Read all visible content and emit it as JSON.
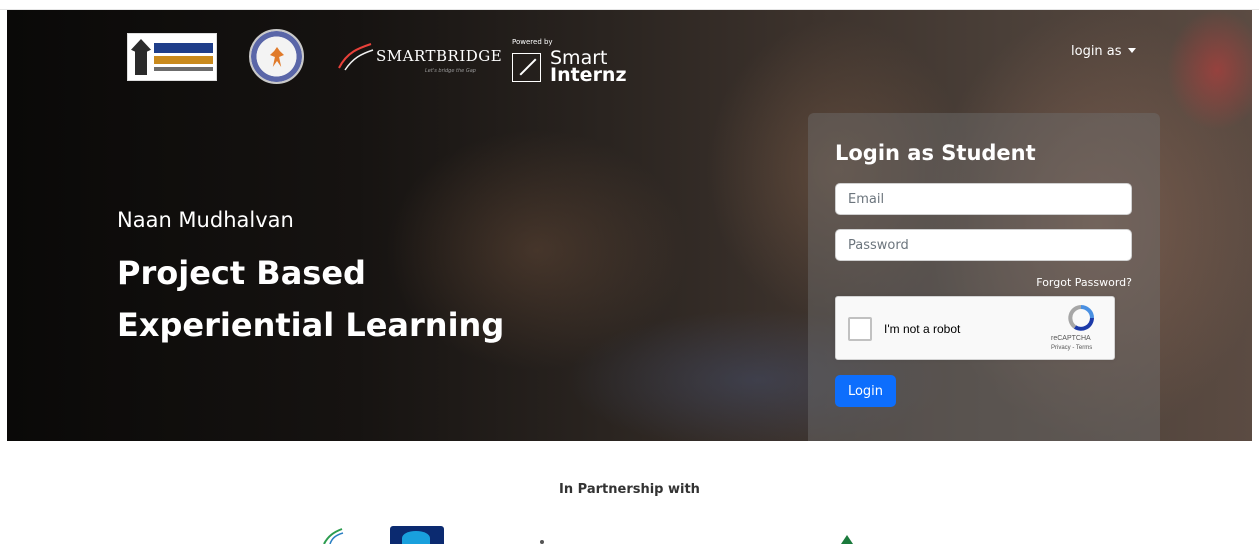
{
  "header": {
    "partner_logo_text": "SMARTBRIDGE",
    "partner_logo_tagline": "Let's bridge the Gap",
    "powered_by": "Powered by",
    "brand_line1": "Smart",
    "brand_line2": "Internz",
    "login_as_label": "login as"
  },
  "hero": {
    "subtitle": "Naan Mudhalvan",
    "title_line1": "Project Based",
    "title_line2": "Experiential Learning"
  },
  "login_card": {
    "title": "Login as Student",
    "email_placeholder": "Email",
    "email_value": "",
    "password_placeholder": "Password",
    "password_value": "",
    "forgot_label": "Forgot Password?",
    "captcha_label": "I'm not a robot",
    "captcha_brand": "reCAPTCHA",
    "captcha_links": "Privacy - Terms",
    "login_button": "Login"
  },
  "footer": {
    "partnership_heading": "In Partnership with"
  },
  "colors": {
    "primary_button": "#0d6efd",
    "hero_text": "#ffffff"
  },
  "icons": {
    "dropdown": "caret-down-icon",
    "captcha": "recaptcha-icon"
  }
}
